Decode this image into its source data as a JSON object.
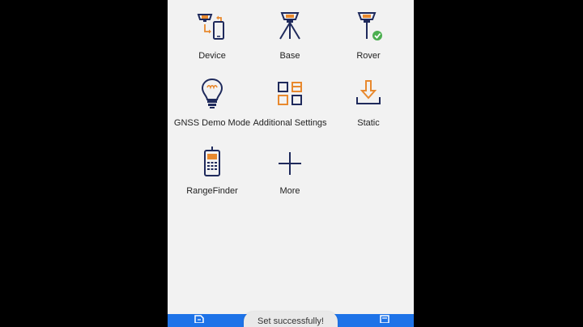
{
  "menu": {
    "items": [
      {
        "id": "device",
        "label": "Device",
        "icon": "device-connect-icon"
      },
      {
        "id": "base",
        "label": "Base",
        "icon": "gnss-base-tripod-icon"
      },
      {
        "id": "rover",
        "label": "Rover",
        "icon": "gnss-rover-check-icon"
      },
      {
        "id": "gnss_demo",
        "label": "GNSS Demo Mode",
        "icon": "lightbulb-icon"
      },
      {
        "id": "additional_settings",
        "label": "Additional Settings",
        "icon": "grid-settings-icon"
      },
      {
        "id": "static",
        "label": "Static",
        "icon": "download-tray-icon"
      },
      {
        "id": "rangefinder",
        "label": "RangeFinder",
        "icon": "rangefinder-device-icon"
      },
      {
        "id": "more",
        "label": "More",
        "icon": "plus-icon"
      }
    ]
  },
  "toast": {
    "text": "Set successfully!"
  },
  "colors": {
    "accent_orange": "#e8892e",
    "icon_navy": "#1f2a5c",
    "status_green": "#4caf50",
    "nav_blue": "#1e73e8"
  }
}
